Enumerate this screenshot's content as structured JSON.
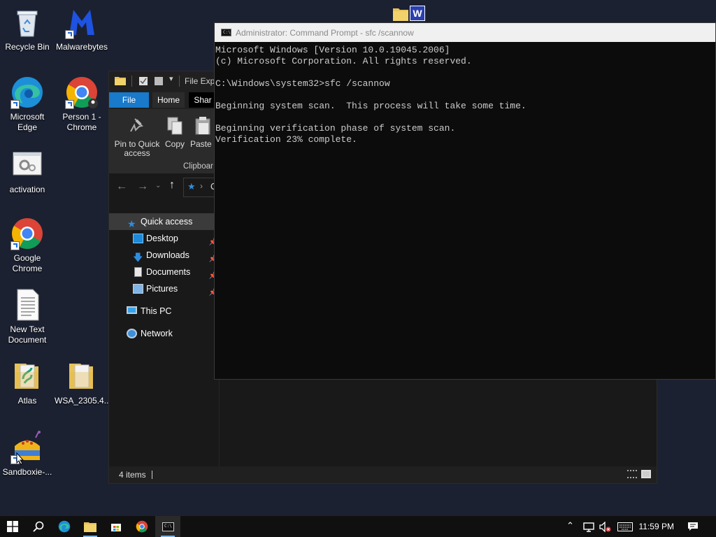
{
  "desktop": {
    "icons": [
      {
        "label": "Recycle Bin"
      },
      {
        "label": "Malwarebytes"
      },
      {
        "label": "Microsoft Edge"
      },
      {
        "label": "Person 1 - Chrome"
      },
      {
        "label": "activation"
      },
      {
        "label": "Google Chrome"
      },
      {
        "label": "New Text Document"
      },
      {
        "label": "Atlas"
      },
      {
        "label": "WSA_2305.4..."
      },
      {
        "label": "Sandboxie-..."
      }
    ]
  },
  "explorer": {
    "title": "File Expl",
    "tabs": {
      "file": "File",
      "home": "Home",
      "share": "Shar"
    },
    "ribbon": {
      "pin": "Pin to Quick access",
      "copy": "Copy",
      "paste": "Paste",
      "group": "Clipboar"
    },
    "address": "C",
    "nav": {
      "quick_access": "Quick access",
      "desktop": "Desktop",
      "downloads": "Downloads",
      "documents": "Documents",
      "pictures": "Pictures",
      "this_pc": "This PC",
      "network": "Network"
    },
    "status": "4 items"
  },
  "cmd": {
    "title": "Administrator: Command Prompt - sfc  /scannow",
    "lines": [
      "Microsoft Windows [Version 10.0.19045.2006]",
      "(c) Microsoft Corporation. All rights reserved.",
      "",
      "C:\\Windows\\system32>sfc /scannow",
      "",
      "Beginning system scan.  This process will take some time.",
      "",
      "Beginning verification phase of system scan.",
      "Verification 23% complete."
    ]
  },
  "taskbar": {
    "time": "11:59 PM"
  }
}
